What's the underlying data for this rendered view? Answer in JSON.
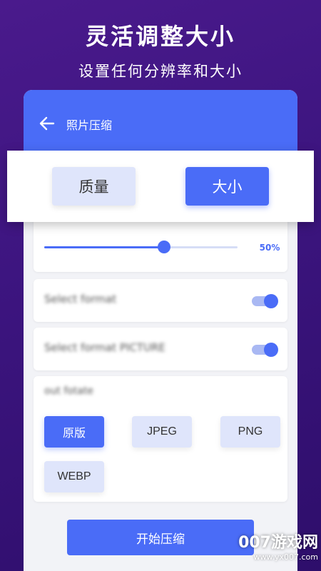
{
  "promo": {
    "headline": "灵活调整大小",
    "subline": "设置任何分辨率和大小"
  },
  "appbar": {
    "title": "照片压缩"
  },
  "tabs": [
    {
      "label": "质量",
      "selected": false
    },
    {
      "label": "大小",
      "selected": true
    }
  ],
  "slider": {
    "value_label": "50%",
    "value": 0.62
  },
  "settings": [
    {
      "label": "Select format",
      "enabled": true
    },
    {
      "label": "Select format PICTURE",
      "enabled": true
    }
  ],
  "output": {
    "label": "out fotate",
    "formats": [
      {
        "label": "原版",
        "selected": true
      },
      {
        "label": "JPEG",
        "selected": false
      },
      {
        "label": "PNG",
        "selected": false
      },
      {
        "label": "WEBP",
        "selected": false
      }
    ]
  },
  "start_button": "开始压缩",
  "watermark": {
    "brand": "007游戏网",
    "url": "www.yx007.com"
  },
  "colors": {
    "accent": "#4a6cf7",
    "background": "#3d1580"
  }
}
